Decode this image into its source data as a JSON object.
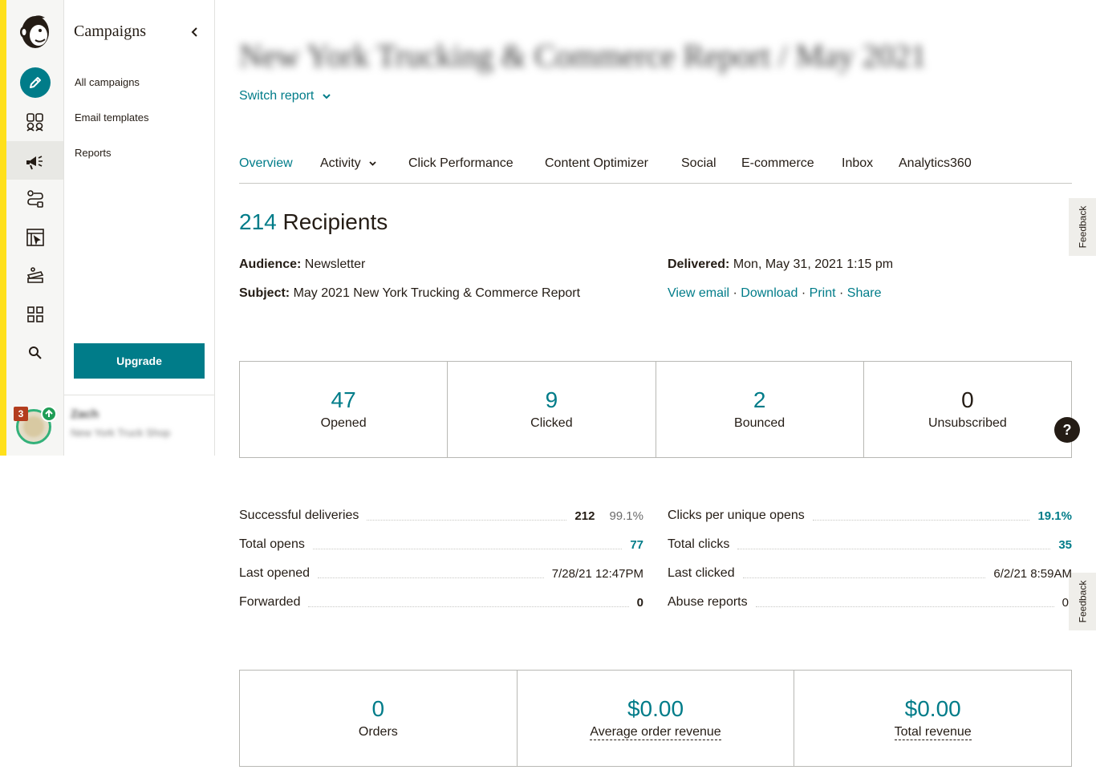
{
  "sidebar": {
    "title": "Campaigns",
    "links": [
      "All campaigns",
      "Email templates",
      "Reports"
    ],
    "upgrade_label": "Upgrade",
    "account_name": "Zach",
    "account_org": "New York Truck Shop",
    "notification_count": "3"
  },
  "report": {
    "title": "New York Trucking & Commerce Report / May 2021",
    "switch_label": "Switch report"
  },
  "tabs": [
    "Overview",
    "Activity",
    "Click Performance",
    "Content Optimizer",
    "Social",
    "E-commerce",
    "Inbox",
    "Analytics360"
  ],
  "feedback_label": "Feedback",
  "summary": {
    "recipients_count": "214",
    "recipients_label": "Recipients",
    "audience_label": "Audience:",
    "audience_value": "Newsletter",
    "subject_label": "Subject:",
    "subject_value": "May 2021 New York Trucking & Commerce Report",
    "delivered_label": "Delivered:",
    "delivered_value": "Mon, May 31, 2021 1:15 pm",
    "links": [
      "View email",
      "Download",
      "Print",
      "Share"
    ],
    "separator": " · "
  },
  "stats": [
    {
      "value": "47",
      "label": "Opened"
    },
    {
      "value": "9",
      "label": "Clicked"
    },
    {
      "value": "2",
      "label": "Bounced"
    },
    {
      "value": "0",
      "label": "Unsubscribed"
    }
  ],
  "help_label": "?",
  "details_left": [
    {
      "key": "Successful deliveries",
      "value": "212",
      "extra": "99.1%"
    },
    {
      "key": "Total opens",
      "value": "77"
    },
    {
      "key": "Last opened",
      "value": "7/28/21 12:47PM"
    },
    {
      "key": "Forwarded",
      "value": "0"
    }
  ],
  "details_right": [
    {
      "key": "Clicks per unique opens",
      "value": "19.1%"
    },
    {
      "key": "Total clicks",
      "value": "35"
    },
    {
      "key": "Last clicked",
      "value": "6/2/21 8:59AM"
    },
    {
      "key": "Abuse reports",
      "value": "0"
    }
  ],
  "ecommerce": [
    {
      "value": "0",
      "label": "Orders"
    },
    {
      "value": "$0.00",
      "label": "Average order revenue"
    },
    {
      "value": "$0.00",
      "label": "Total revenue"
    }
  ],
  "colors": {
    "accent": "#007c89",
    "brand_yellow": "#ffe01b",
    "text": "#241c15"
  }
}
